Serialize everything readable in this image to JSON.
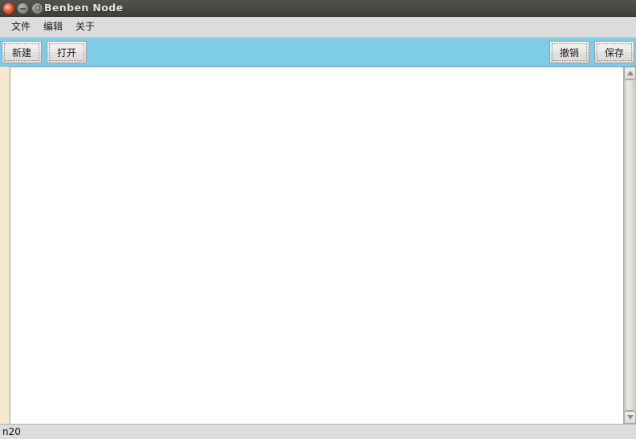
{
  "window": {
    "title": "Benben Node",
    "controls": [
      {
        "name": "close",
        "icon": "close-icon"
      },
      {
        "name": "minimize",
        "icon": "minimize-icon"
      },
      {
        "name": "maximize",
        "icon": "maximize-icon"
      }
    ]
  },
  "menubar": {
    "items": [
      {
        "label": "文件"
      },
      {
        "label": "编辑"
      },
      {
        "label": "关于"
      }
    ]
  },
  "toolbar": {
    "accent_color": "#7fcce8",
    "left_buttons": [
      {
        "label": "新建",
        "name": "new-button"
      },
      {
        "label": "打开",
        "name": "open-button"
      }
    ],
    "right_buttons": [
      {
        "label": "撤销",
        "name": "undo-button"
      },
      {
        "label": "保存",
        "name": "save-button"
      }
    ]
  },
  "editor": {
    "content": "",
    "gutter_color": "#f6e8ce",
    "background_color": "#ffffff"
  },
  "scrollbar": {
    "up_arrow": "scroll-up-icon",
    "down_arrow": "scroll-down-icon",
    "thumb_position": 0,
    "thumb_size_percent": 100
  },
  "statusbar": {
    "text": "n20"
  }
}
